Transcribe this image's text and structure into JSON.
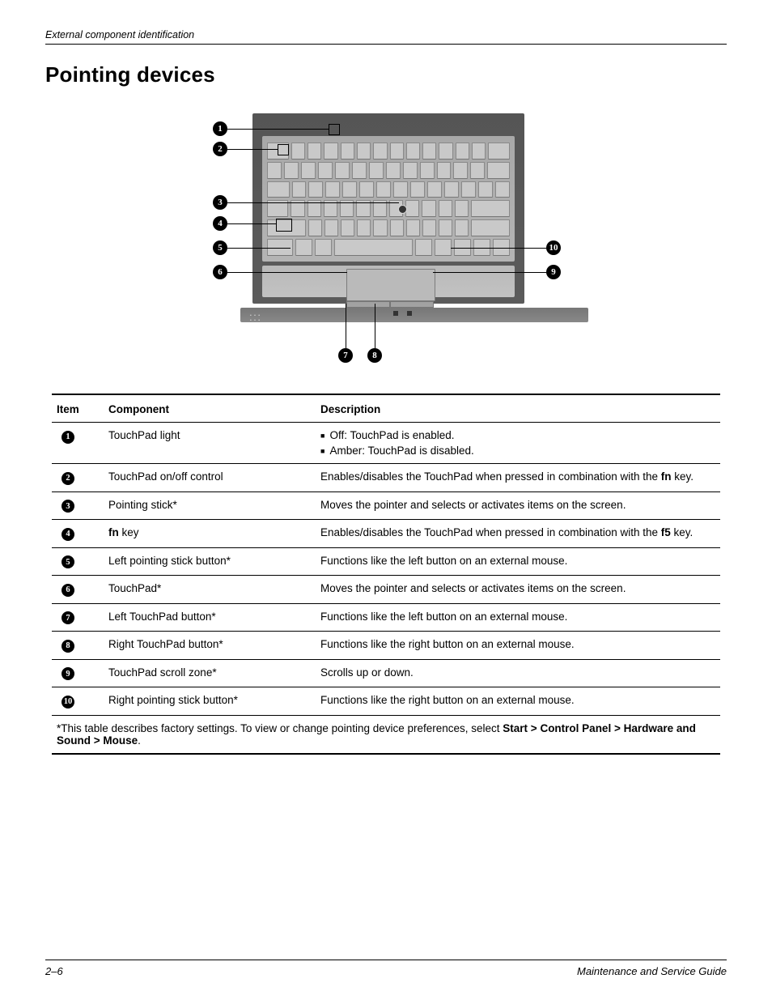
{
  "header": {
    "running": "External component identification"
  },
  "section": {
    "title": "Pointing devices"
  },
  "diagram": {
    "callouts": [
      "1",
      "2",
      "3",
      "4",
      "5",
      "6",
      "7",
      "8",
      "9",
      "10"
    ]
  },
  "table": {
    "headers": {
      "item": "Item",
      "component": "Component",
      "description": "Description"
    },
    "rows": [
      {
        "num": "1",
        "component": "TouchPad light",
        "description_list": [
          "Off: TouchPad is enabled.",
          "Amber: TouchPad is disabled."
        ]
      },
      {
        "num": "2",
        "component": "TouchPad on/off control",
        "description_html": "Enables/disables the TouchPad when pressed in combination with the <b>fn</b> key."
      },
      {
        "num": "3",
        "component": "Pointing stick*",
        "description": "Moves the pointer and selects or activates items on the screen."
      },
      {
        "num": "4",
        "component_html": "<b>fn</b> key",
        "description_html": "Enables/disables the TouchPad when pressed in combination with the <b>f5</b> key."
      },
      {
        "num": "5",
        "component": "Left pointing stick button*",
        "description": "Functions like the left button on an external mouse."
      },
      {
        "num": "6",
        "component": "TouchPad*",
        "description": "Moves the pointer and selects or activates items on the screen."
      },
      {
        "num": "7",
        "component": "Left TouchPad button*",
        "description": "Functions like the left button on an external mouse."
      },
      {
        "num": "8",
        "component": "Right TouchPad button*",
        "description": "Functions like the right button on an external mouse."
      },
      {
        "num": "9",
        "component": "TouchPad scroll zone*",
        "description": "Scrolls up or down."
      },
      {
        "num": "10",
        "component": "Right pointing stick button*",
        "description": "Functions like the right button on an external mouse."
      }
    ],
    "footnote_html": "*This table describes factory settings. To view or change pointing device preferences, select <b>Start &gt; Control Panel &gt; Hardware and Sound &gt; Mouse</b>."
  },
  "footer": {
    "page_number": "2–6",
    "guide": "Maintenance and Service Guide"
  }
}
